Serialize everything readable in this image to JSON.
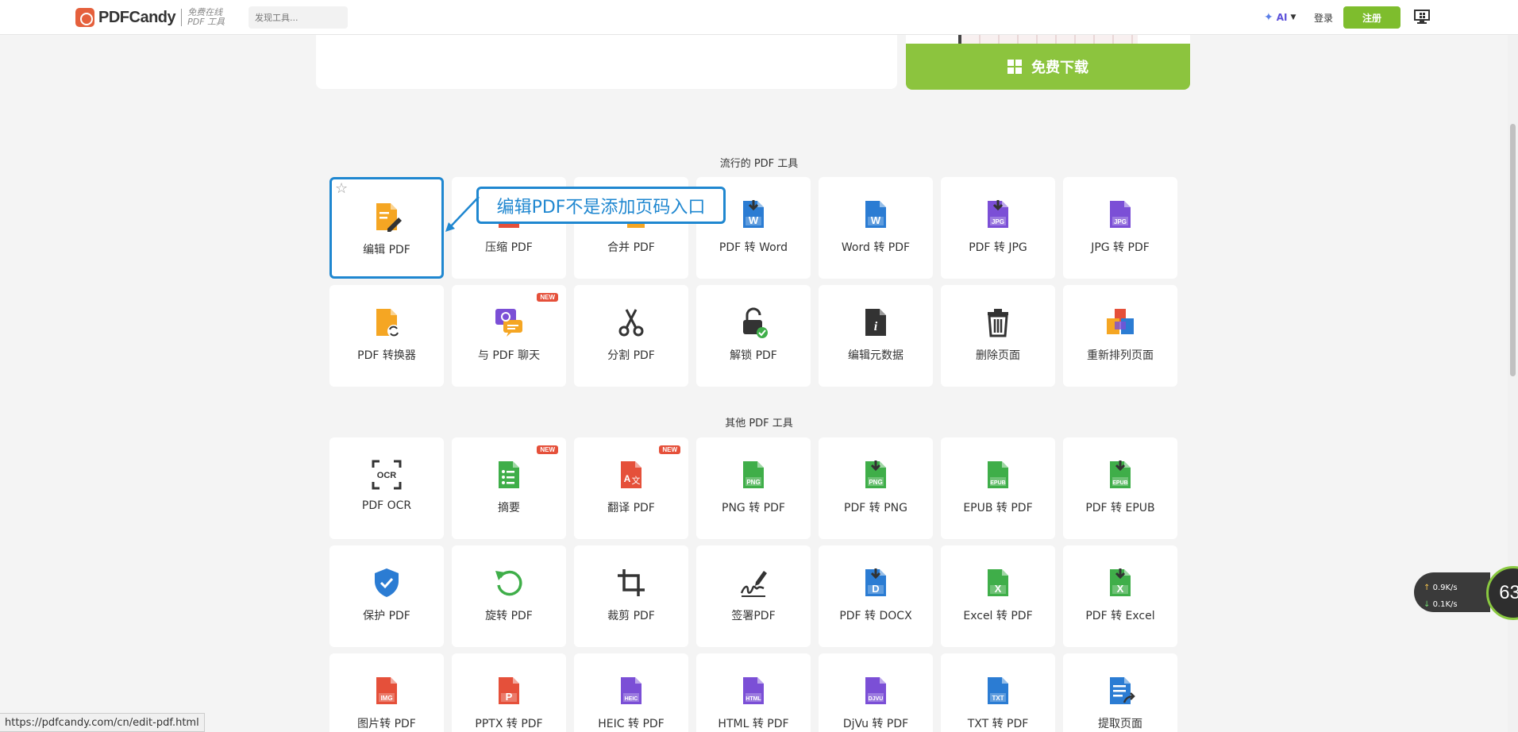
{
  "header": {
    "logo_text": "PDFCandy",
    "logo_sub": "免费在线 PDF 工具",
    "search_placeholder": "发现工具...",
    "ai_label": "AI",
    "login_label": "登录",
    "register_label": "注册"
  },
  "promo": {
    "download_label": "免费下载"
  },
  "sections": {
    "popular_title": "流行的 PDF 工具",
    "other_title": "其他 PDF 工具"
  },
  "popular_tools": [
    {
      "label": "编辑 PDF",
      "icon": "edit-pdf-icon",
      "color": "#f5a623"
    },
    {
      "label": "压缩 PDF",
      "icon": "compress-pdf-icon",
      "color": "#e5503a"
    },
    {
      "label": "合并 PDF",
      "icon": "merge-pdf-icon",
      "color": "#f5a623"
    },
    {
      "label": "PDF 转 Word",
      "icon": "pdf-to-word-icon",
      "color": "#2b7cd3"
    },
    {
      "label": "Word 转 PDF",
      "icon": "word-to-pdf-icon",
      "color": "#2b7cd3"
    },
    {
      "label": "PDF 转 JPG",
      "icon": "pdf-to-jpg-icon",
      "color": "#7b4fd6"
    },
    {
      "label": "JPG 转 PDF",
      "icon": "jpg-to-pdf-icon",
      "color": "#7b4fd6"
    },
    {
      "label": "PDF 转换器",
      "icon": "pdf-converter-icon",
      "color": "#f5a623"
    },
    {
      "label": "与 PDF 聊天",
      "icon": "chat-pdf-icon",
      "color": "#7b4fd6",
      "badge": "NEW"
    },
    {
      "label": "分割 PDF",
      "icon": "scissors-icon",
      "color": "#333333"
    },
    {
      "label": "解锁 PDF",
      "icon": "unlock-icon",
      "color": "#333333"
    },
    {
      "label": "编辑元数据",
      "icon": "metadata-icon",
      "color": "#333333"
    },
    {
      "label": "删除页面",
      "icon": "trash-icon",
      "color": "#333333"
    },
    {
      "label": "重新排列页面",
      "icon": "rearrange-icon",
      "color": "#e5503a"
    }
  ],
  "other_tools": [
    {
      "label": "PDF OCR",
      "icon": "ocr-icon",
      "color": "#333333"
    },
    {
      "label": "摘要",
      "icon": "summary-icon",
      "color": "#3fae49",
      "badge": "NEW"
    },
    {
      "label": "翻译 PDF",
      "icon": "translate-icon",
      "color": "#e5503a",
      "badge": "NEW"
    },
    {
      "label": "PNG 转 PDF",
      "icon": "png-to-pdf-icon",
      "color": "#3fae49"
    },
    {
      "label": "PDF 转 PNG",
      "icon": "pdf-to-png-icon",
      "color": "#3fae49"
    },
    {
      "label": "EPUB 转 PDF",
      "icon": "epub-to-pdf-icon",
      "color": "#3fae49"
    },
    {
      "label": "PDF 转 EPUB",
      "icon": "pdf-to-epub-icon",
      "color": "#3fae49"
    },
    {
      "label": "保护 PDF",
      "icon": "shield-icon",
      "color": "#2b7cd3"
    },
    {
      "label": "旋转 PDF",
      "icon": "rotate-icon",
      "color": "#3fae49"
    },
    {
      "label": "裁剪 PDF",
      "icon": "crop-icon",
      "color": "#333333"
    },
    {
      "label": "签署PDF",
      "icon": "signature-icon",
      "color": "#333333"
    },
    {
      "label": "PDF 转 DOCX",
      "icon": "pdf-to-docx-icon",
      "color": "#2b7cd3"
    },
    {
      "label": "Excel 转 PDF",
      "icon": "excel-to-pdf-icon",
      "color": "#3fae49"
    },
    {
      "label": "PDF 转 Excel",
      "icon": "pdf-to-excel-icon",
      "color": "#3fae49"
    },
    {
      "label": "图片转 PDF",
      "icon": "img-to-pdf-icon",
      "color": "#e5503a"
    },
    {
      "label": "PPTX 转 PDF",
      "icon": "pptx-to-pdf-icon",
      "color": "#e5503a"
    },
    {
      "label": "HEIC 转 PDF",
      "icon": "heic-to-pdf-icon",
      "color": "#7b4fd6"
    },
    {
      "label": "HTML 转 PDF",
      "icon": "html-to-pdf-icon",
      "color": "#7b4fd6"
    },
    {
      "label": "DjVu 转 PDF",
      "icon": "djvu-to-pdf-icon",
      "color": "#7b4fd6"
    },
    {
      "label": "TXT 转 PDF",
      "icon": "txt-to-pdf-icon",
      "color": "#2b7cd3"
    },
    {
      "label": "提取页面",
      "icon": "extract-pages-icon",
      "color": "#2b7cd3"
    }
  ],
  "annotation": {
    "text": "编辑PDF不是添加页码入口"
  },
  "status_url": "https://pdfcandy.com/cn/edit-pdf.html",
  "network": {
    "upload": "0.9",
    "download": "0.1",
    "unit": "K/s",
    "percent": "63",
    "percent_sign": "%"
  }
}
